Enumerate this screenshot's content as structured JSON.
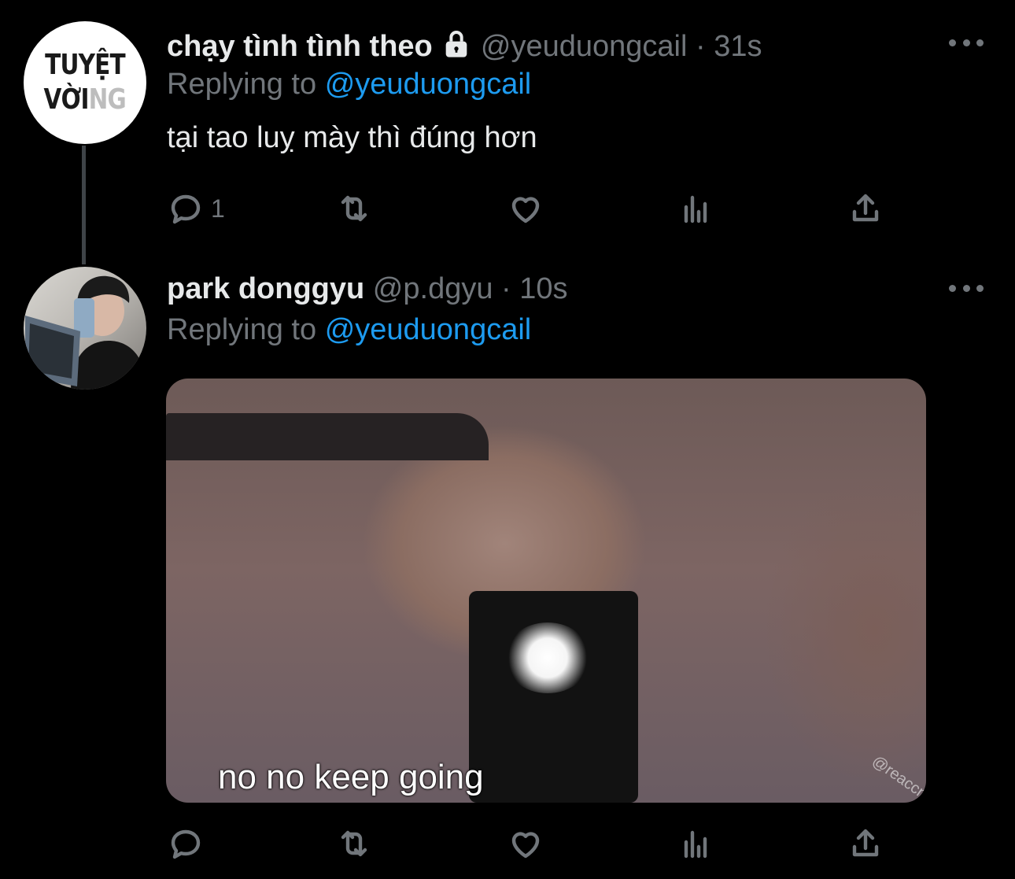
{
  "tweet1": {
    "avatar_text_line1": "TUYỆT",
    "avatar_text_line2a": "VỜI",
    "avatar_text_line2b": "NG",
    "display_name": "chạy tình tình theo",
    "handle": "@yeuduongcail",
    "separator": "·",
    "time": "31s",
    "replying_prefix": "Replying to",
    "replying_to": "@yeuduongcail",
    "text": "tại tao luỵ mày thì đúng hơn",
    "reply_count": "1"
  },
  "tweet2": {
    "display_name": "park donggyu",
    "handle": "@p.dgyu",
    "separator": "·",
    "time": "10s",
    "replying_prefix": "Replying to",
    "replying_to": "@yeuduongcail",
    "media_caption": "no no keep going",
    "media_watermark": "@reaccn"
  },
  "icons": [
    "lock-icon",
    "more-icon",
    "reply-icon",
    "retweet-icon",
    "like-icon",
    "views-icon",
    "share-icon"
  ],
  "colors": {
    "background": "#000000",
    "text": "#e7e9ea",
    "muted": "#71767b",
    "link": "#1d9bf0"
  }
}
